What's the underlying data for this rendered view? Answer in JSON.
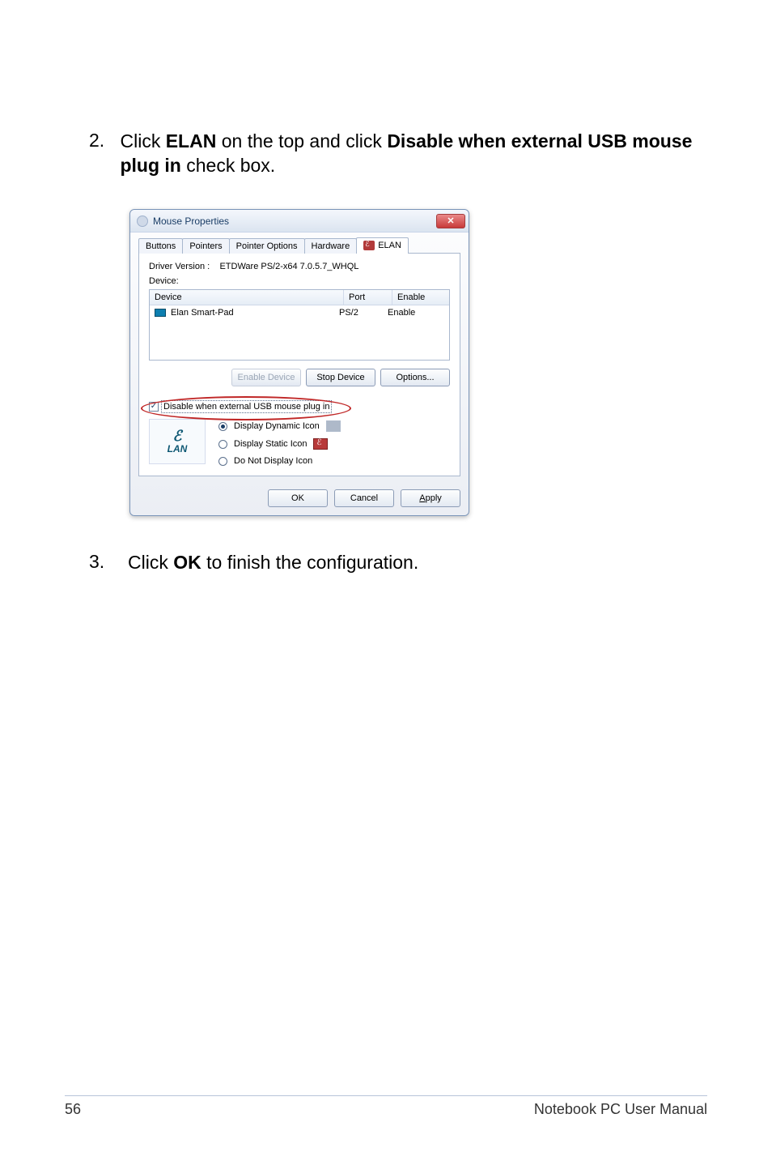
{
  "steps": {
    "s2_num": "2.",
    "s2_pre": "Click ",
    "s2_b1": "ELAN",
    "s2_mid": " on the top and click ",
    "s2_b2": "Disable when external USB mouse plug in",
    "s2_post": " check box.",
    "s3_num": "3.",
    "s3_pre": "Click ",
    "s3_b1": "OK",
    "s3_post": " to finish the configuration."
  },
  "dialog": {
    "title": "Mouse Properties",
    "close_glyph": "✕",
    "tabs": {
      "buttons": "Buttons",
      "pointers": "Pointers",
      "pointer_options": "Pointer Options",
      "hardware": "Hardware",
      "elan": "ELAN"
    },
    "driver_label": "Driver Version :",
    "driver_value": "ETDWare PS/2-x64 7.0.5.7_WHQL",
    "device_label": "Device:",
    "cols": {
      "device": "Device",
      "port": "Port",
      "enable": "Enable"
    },
    "row": {
      "name": "Elan Smart-Pad",
      "port": "PS/2",
      "enable": "Enable"
    },
    "btn_enable": "Enable Device",
    "btn_stop": "Stop Device",
    "btn_options": "Options...",
    "checkbox_label": "Disable when external USB mouse plug in",
    "radios": {
      "dynamic": "Display Dynamic Icon",
      "static": "Display Static Icon",
      "none": "Do Not Display Icon"
    },
    "logo_text": "LAN",
    "ok": "OK",
    "cancel": "Cancel",
    "apply": "Apply"
  },
  "footer": {
    "page": "56",
    "right": "Notebook PC User Manual"
  }
}
